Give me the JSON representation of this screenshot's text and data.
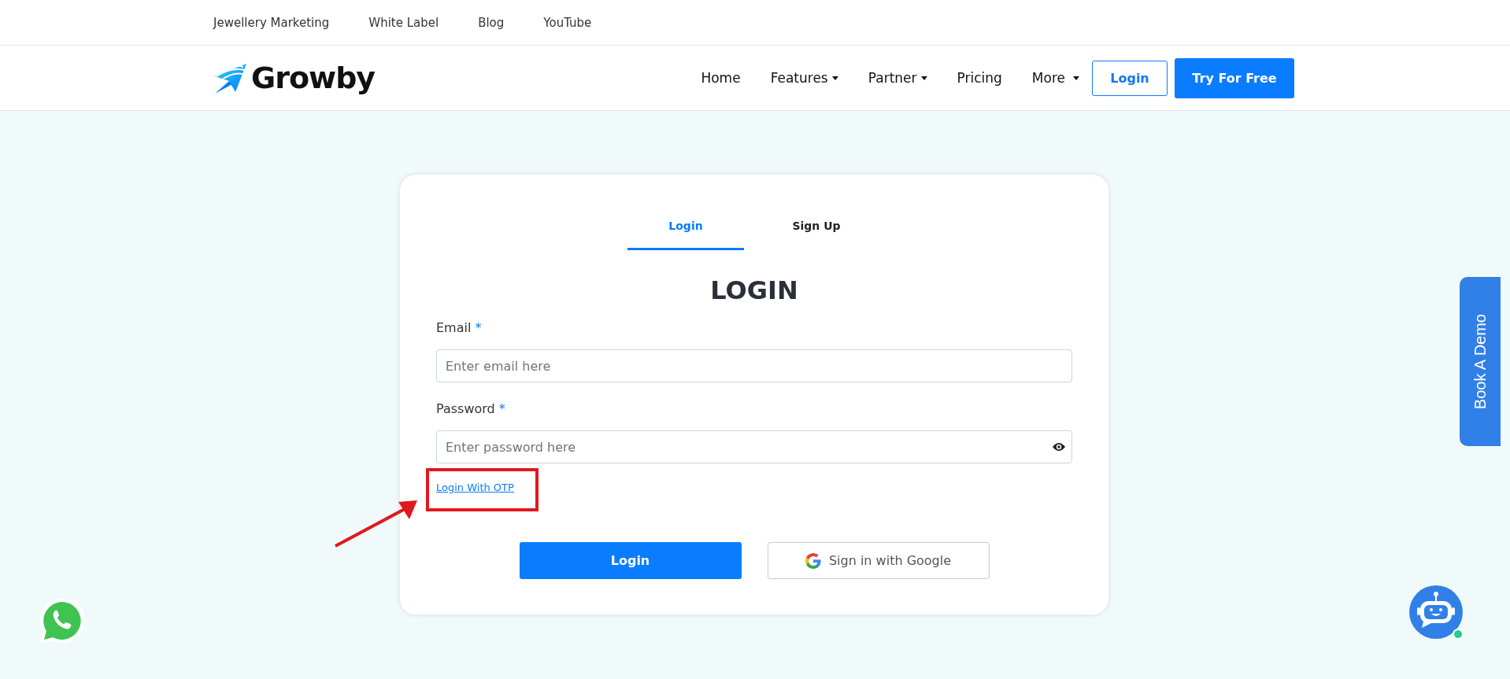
{
  "top_links": [
    {
      "label": "Jewellery Marketing"
    },
    {
      "label": "White Label"
    },
    {
      "label": "Blog"
    },
    {
      "label": "YouTube"
    }
  ],
  "nav": {
    "logo": "Growby",
    "items": [
      {
        "label": "Home",
        "dropdown": false
      },
      {
        "label": "Features",
        "dropdown": true
      },
      {
        "label": "Partner",
        "dropdown": true
      },
      {
        "label": "Pricing",
        "dropdown": false
      },
      {
        "label": "More",
        "dropdown": true
      }
    ],
    "login_button": "Login",
    "cta_button": "Try For Free"
  },
  "card": {
    "tabs": [
      {
        "label": "Login",
        "selected": true
      },
      {
        "label": "Sign Up",
        "selected": false
      }
    ],
    "heading": "LOGIN",
    "fields": [
      {
        "label": "Email",
        "required_mark": "*",
        "placeholder": "Enter email here",
        "kind": "text"
      },
      {
        "label": "Password",
        "required_mark": "*",
        "placeholder": "Enter password here",
        "kind": "password"
      }
    ],
    "otp_link": "Login With OTP",
    "submit_button": "Login",
    "google_button": "Sign in with Google"
  },
  "book_demo": "Book A Demo"
}
